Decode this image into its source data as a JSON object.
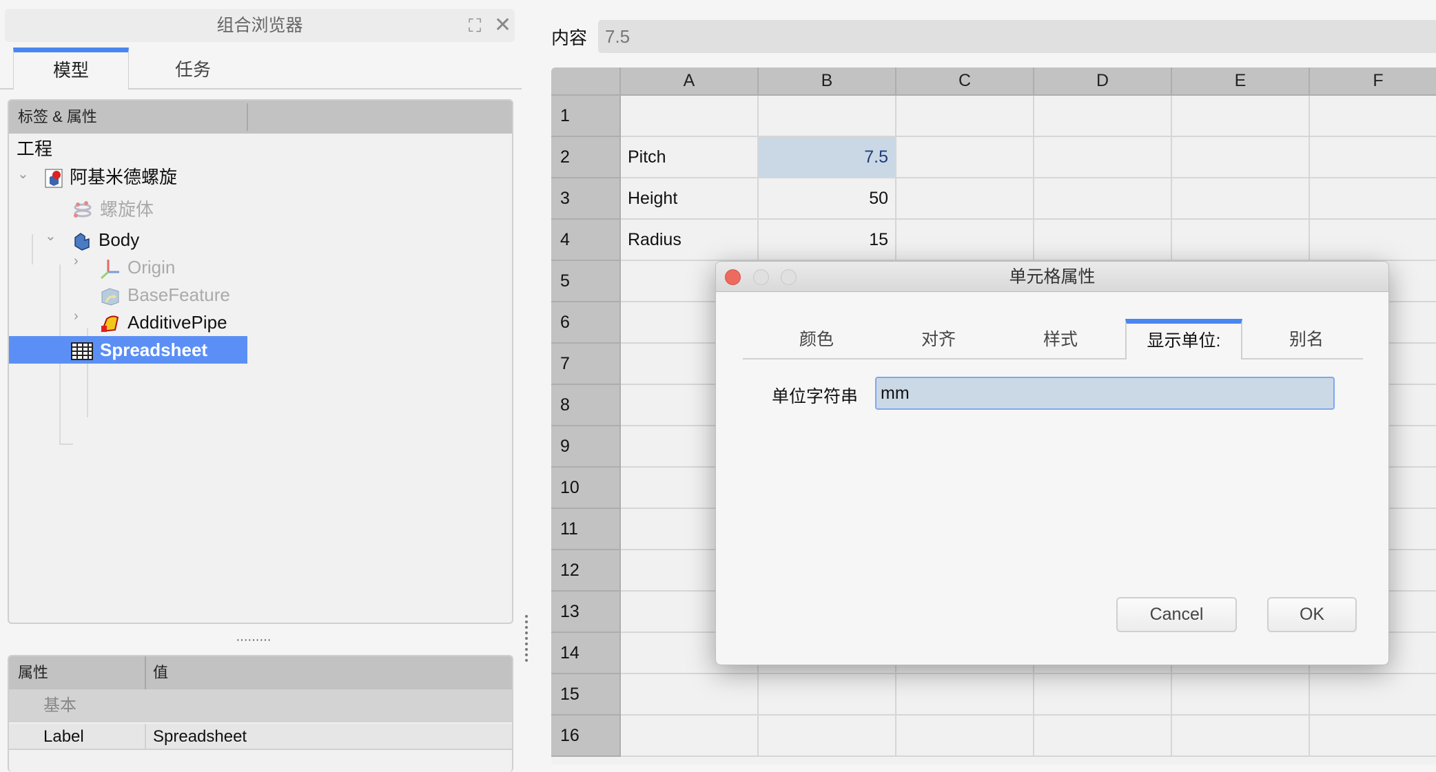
{
  "combo": {
    "title": "组合浏览器",
    "tabs": [
      {
        "label": "模型"
      },
      {
        "label": "任务"
      }
    ],
    "tree_header": "标签 & 属性",
    "tree": {
      "root": "工程",
      "items": [
        {
          "label": "阿基米德螺旋",
          "icon": "document-icon"
        },
        {
          "label": "螺旋体",
          "icon": "helix-icon"
        },
        {
          "label": "Body",
          "icon": "body-icon"
        },
        {
          "label": "Origin",
          "icon": "origin-icon"
        },
        {
          "label": "BaseFeature",
          "icon": "base-feature-icon"
        },
        {
          "label": "AdditivePipe",
          "icon": "additive-pipe-icon"
        },
        {
          "label": "Spreadsheet",
          "icon": "spreadsheet-icon"
        }
      ]
    },
    "props": {
      "headers": [
        "属性",
        "值"
      ],
      "group": "基本",
      "rows": [
        {
          "name": "Label",
          "value": "Spreadsheet"
        }
      ]
    }
  },
  "spreadsheet": {
    "content_label": "内容",
    "content_value": "7.5",
    "columns": [
      "A",
      "B",
      "C",
      "D",
      "E",
      "F"
    ],
    "rows": [
      "1",
      "2",
      "3",
      "4",
      "5",
      "6",
      "7",
      "8",
      "9",
      "10",
      "11",
      "12",
      "13",
      "14",
      "15",
      "16"
    ],
    "cells": {
      "A2": "Pitch",
      "B2": "7.5",
      "A3": "Height",
      "B3": "50",
      "A4": "Radius",
      "B4": "15"
    },
    "selected": "B2"
  },
  "dialog": {
    "title": "单元格属性",
    "tabs": [
      {
        "label": "颜色"
      },
      {
        "label": "对齐"
      },
      {
        "label": "样式"
      },
      {
        "label": "显示单位:"
      },
      {
        "label": "别名"
      }
    ],
    "unit_label": "单位字符串",
    "unit_value": "mm",
    "cancel": "Cancel",
    "ok": "OK"
  },
  "colors": {
    "accent": "#4a86f0",
    "selection": "#5b8ff5",
    "close": "#ec6a5e"
  }
}
